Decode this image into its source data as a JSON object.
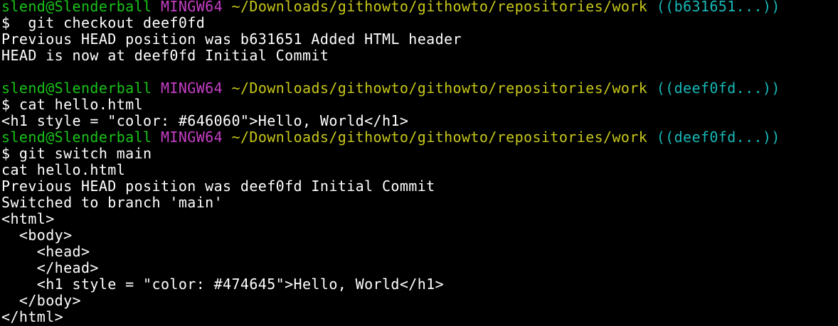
{
  "terminal": {
    "colors": {
      "background": "#000000",
      "text": "#ffffff",
      "user_host": "#19c419",
      "system": "#c63fc6",
      "path": "#c8c81a",
      "branch": "#17b8b8"
    },
    "prompts": [
      {
        "user_host": "slend@Slenderball",
        "system": "MINGW64",
        "path": "~/Downloads/githowto/githowto/repositories/work",
        "branch": "((b631651...))",
        "command": "$  git checkout deef0fd"
      },
      {
        "user_host": "slend@Slenderball",
        "system": "MINGW64",
        "path": "~/Downloads/githowto/githowto/repositories/work",
        "branch": "((deef0fd...))",
        "command": "$ cat hello.html"
      },
      {
        "user_host": "slend@Slenderball",
        "system": "MINGW64",
        "path": "~/Downloads/githowto/githowto/repositories/work",
        "branch": "((deef0fd...))",
        "command": "$ git switch main"
      }
    ],
    "output_1": [
      "Previous HEAD position was b631651 Added HTML header",
      "HEAD is now at deef0fd Initial Commit"
    ],
    "output_2": [
      "<h1 style = \"color: #646060\">Hello, World</h1>"
    ],
    "output_3": [
      "cat hello.html",
      "Previous HEAD position was deef0fd Initial Commit",
      "Switched to branch 'main'",
      "<html>",
      "  <body>",
      "    <head>",
      "    </head>",
      "    <h1 style = \"color: #474645\">Hello, World</h1>",
      "  </body>",
      "</html>"
    ]
  }
}
